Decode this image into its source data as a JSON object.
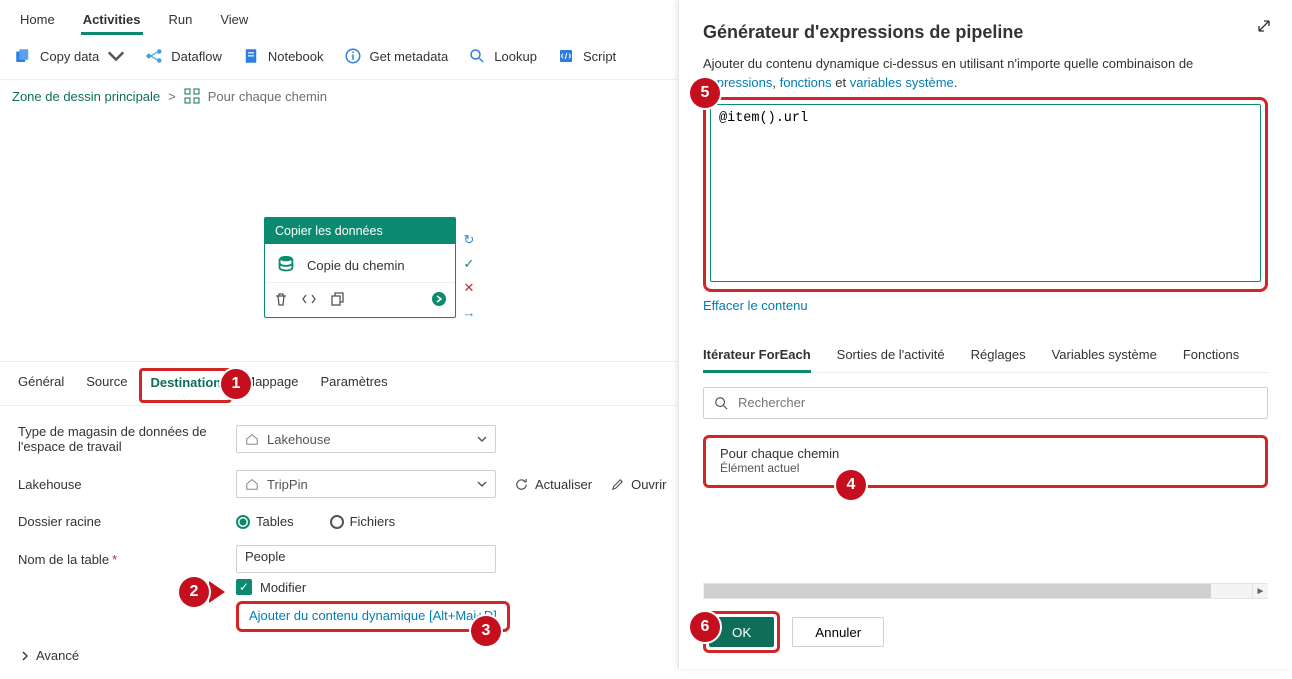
{
  "topmenu": {
    "items": [
      "Home",
      "Activities",
      "Run",
      "View"
    ],
    "active": 1
  },
  "toolbar": {
    "copy": "Copy data",
    "dataflow": "Dataflow",
    "notebook": "Notebook",
    "getmeta": "Get metadata",
    "lookup": "Lookup",
    "script": "Script"
  },
  "breadcrumb": {
    "root": "Zone de dessin principale",
    "sep": ">",
    "current": "Pour chaque chemin"
  },
  "activity": {
    "header": "Copier les données",
    "title": "Copie du chemin"
  },
  "prop_tabs": [
    "Général",
    "Source",
    "Destination",
    "Mappage",
    "Paramètres"
  ],
  "form": {
    "store_type_label": "Type de magasin de données de l'espace de travail",
    "store_type_value": "Lakehouse",
    "lakehouse_label": "Lakehouse",
    "lakehouse_value": "TripPin",
    "refresh": "Actualiser",
    "open": "Ouvrir",
    "root_label": "Dossier racine",
    "root_tables": "Tables",
    "root_files": "Fichiers",
    "table_label": "Nom de la table",
    "table_value": "People",
    "modifier": "Modifier",
    "dyn": "Ajouter du contenu dynamique [Alt+Maj+D]",
    "advanced": "Avancé"
  },
  "panel": {
    "title": "Générateur d'expressions de pipeline",
    "help1": "Ajouter du contenu dynamique ci-dessus en utilisant n'importe quelle combinaison de ",
    "link1": "expressions",
    "help2": ", ",
    "link2": "fonctions",
    "help3": " et ",
    "link3": "variables système",
    "help4": ".",
    "expr": "@item().url",
    "clear": "Effacer le contenu",
    "fntabs": [
      "Itérateur ForEach",
      "Sorties de l'activité",
      "Réglages",
      "Variables système",
      "Fonctions"
    ],
    "fntab_active": 0,
    "search_placeholder": "Rechercher",
    "item_title": "Pour chaque chemin",
    "item_sub": "Élément actuel",
    "ok": "OK",
    "cancel": "Annuler"
  },
  "markers": {
    "m1": "1",
    "m2": "2",
    "m3": "3",
    "m4": "4",
    "m5": "5",
    "m6": "6"
  }
}
